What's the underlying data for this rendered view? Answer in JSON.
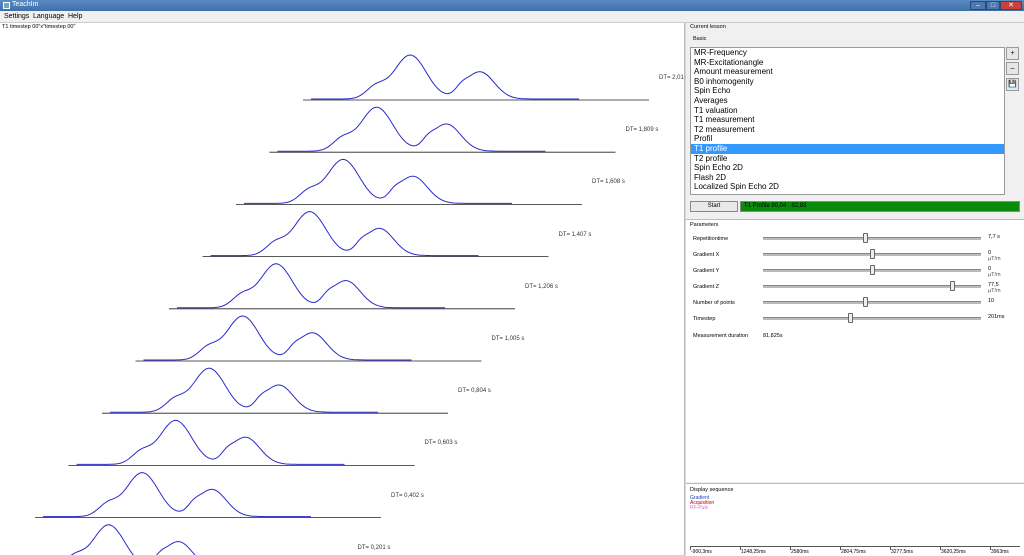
{
  "window": {
    "title": "TeachIm"
  },
  "menu": {
    "items": [
      "Settings",
      "Language",
      "Help"
    ]
  },
  "plot": {
    "header": "T1 timestep 00\"x\"timestep 00\"",
    "traces": [
      {
        "label": "DT= 2,01 s"
      },
      {
        "label": "DT= 1,809 s"
      },
      {
        "label": "DT= 1,608 s"
      },
      {
        "label": "DT= 1,407 s"
      },
      {
        "label": "DT= 1,206 s"
      },
      {
        "label": "DT= 1,005 s"
      },
      {
        "label": "DT= 0,804 s"
      },
      {
        "label": "DT= 0,603 s"
      },
      {
        "label": "DT= 0,402 s"
      },
      {
        "label": "DT= 0,201 s"
      }
    ]
  },
  "lesson": {
    "group_title": "Current lesson",
    "subgroup": "Basic",
    "items": [
      "MR-Frequency",
      "MR-Excitationangle",
      "Amount measurement",
      "B0 inhomogenity",
      "Spin Echo",
      "Averages",
      "T1 valuation",
      "T1 measurement",
      "T2 measurement",
      "Profil",
      "T1 profile",
      "T2 profile",
      "Spin Echo 2D",
      "Flash 2D",
      "Localized Spin Echo 2D"
    ],
    "selected_index": 10,
    "side_buttons": [
      "+",
      "–",
      "💾"
    ],
    "start_label": "Start",
    "progress_text": "T1 Profile 80,04 : 82,83",
    "progress_fraction": 1.0
  },
  "parameters": {
    "group_title": "Parameters",
    "rows": [
      {
        "label": "Repetitiontime",
        "value": "7,7 s",
        "unit": "",
        "pos": 0.47
      },
      {
        "label": "Gradient X",
        "value": "0",
        "unit": "µT/m",
        "pos": 0.5
      },
      {
        "label": "Gradient Y",
        "value": "0",
        "unit": "µT/m",
        "pos": 0.5
      },
      {
        "label": "Gradient Z",
        "value": "77,5",
        "unit": "µT/m",
        "pos": 0.88
      },
      {
        "label": "Number of points",
        "value": "10",
        "unit": "",
        "pos": 0.47
      },
      {
        "label": "Timestep",
        "value": "201ms",
        "unit": "",
        "pos": 0.4
      }
    ],
    "duration_label": "Measurement duration",
    "duration_value": "81,825s"
  },
  "sequence": {
    "group_title": "Display sequence",
    "legend": [
      {
        "name": "Gradient",
        "color": "#1f3fbf"
      },
      {
        "name": "Acquisition",
        "color": "#c00000"
      },
      {
        "name": "RF-Puls",
        "color": "#d070d0"
      }
    ],
    "ticks": [
      "-900,3ms",
      "1248,25ms",
      "2580ms",
      "2804,75ms",
      "3277,5ms",
      "3620,25ms",
      "3963ms"
    ]
  },
  "colors": {
    "trace": "#2a2ac8",
    "selection": "#3399ff",
    "progress": "#0a8a0a"
  }
}
